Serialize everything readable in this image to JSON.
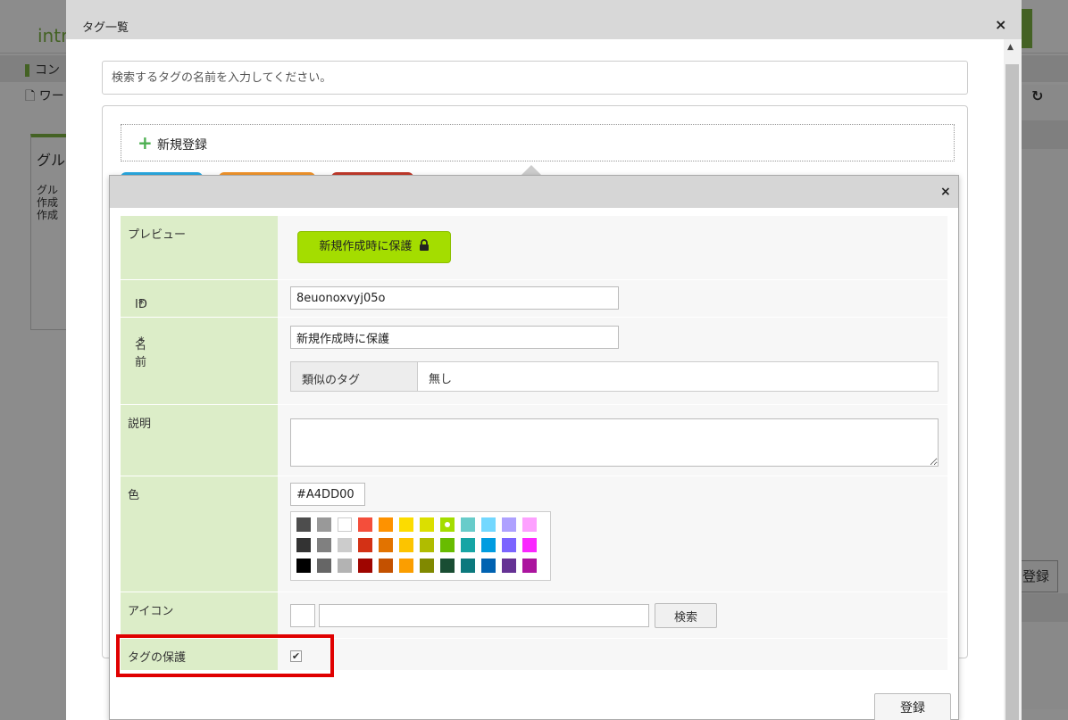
{
  "background": {
    "logo_text": "intr",
    "logo_badge": "i",
    "nav": [
      {
        "label": "コン"
      },
      {
        "label": "ワー"
      }
    ],
    "card": {
      "title": "グル",
      "lines": [
        "グル",
        "作成",
        "作成"
      ]
    },
    "reload_icon": "↻",
    "right_button": "登録"
  },
  "outer_dialog": {
    "title": "タグ一覧",
    "close": "×",
    "search_placeholder": "検索するタグの名前を入力してください。",
    "new_registration": "新規登録",
    "tag_chip_colors": [
      "#29a8e0",
      "#f0932b",
      "#c0392b"
    ]
  },
  "tag_form": {
    "close": "×",
    "preview": {
      "label": "プレビュー",
      "tag_text": "新規作成時に保護",
      "tag_color": "#A4DD00",
      "lock_icon": "lock-icon"
    },
    "id": {
      "label": "ID",
      "required_mark": "*",
      "value": "8euonoxvyj05o"
    },
    "name": {
      "label": "名前",
      "required_mark": "*",
      "value": "新規作成時に保護"
    },
    "similar_tags": {
      "label": "類似のタグ",
      "value": "無し"
    },
    "description": {
      "label": "説明",
      "value": ""
    },
    "color": {
      "label": "色",
      "value": "#A4DD00",
      "selected": "#a4dd00",
      "palette": [
        [
          "#4d4d4d",
          "#999999",
          "#ffffff",
          "#f44e3b",
          "#fe9200",
          "#fcdc00",
          "#dbdf00",
          "#a4dd00",
          "#68ccca",
          "#73d8ff",
          "#aea1ff",
          "#fda1ff"
        ],
        [
          "#333333",
          "#808080",
          "#cccccc",
          "#d33115",
          "#e27300",
          "#fcc400",
          "#b0bc00",
          "#68bc00",
          "#16a5a5",
          "#009ce0",
          "#7b64ff",
          "#fa28ff"
        ],
        [
          "#000000",
          "#666666",
          "#b3b3b3",
          "#9f0500",
          "#c45100",
          "#fb9e00",
          "#808900",
          "#194d33",
          "#0c797d",
          "#0062b1",
          "#653294",
          "#ab149e"
        ]
      ]
    },
    "icon": {
      "label": "アイコン",
      "value": "",
      "search_button": "検索"
    },
    "protection": {
      "label": "タグの保護",
      "checked": true,
      "check_mark": "✔"
    },
    "submit": "登録"
  }
}
